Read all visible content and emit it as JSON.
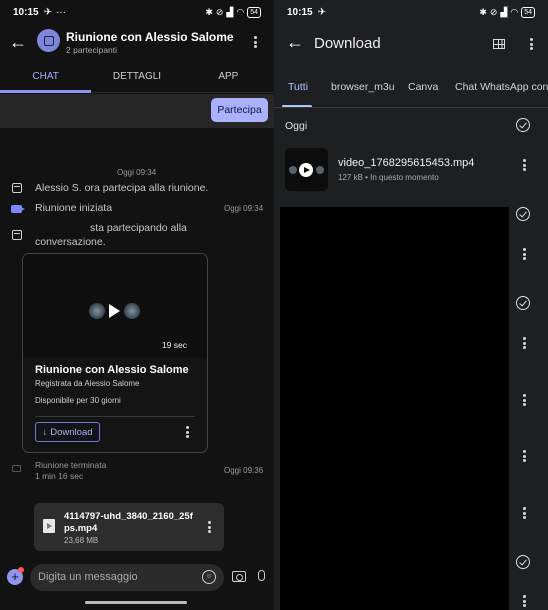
{
  "left": {
    "status": {
      "time": "10:15",
      "battery": "54"
    },
    "header": {
      "title": "Riunione con Alessio Salome",
      "subtitle": "2 partecipanti"
    },
    "tabs": [
      "CHAT",
      "DETTAGLI",
      "APP"
    ],
    "join_button": "Partecipa",
    "chat": {
      "timestamp1": "Oggi 09:34",
      "event_joined": "Alessio S. ora partecipa alla riunione.",
      "event_started": "Riunione iniziata",
      "event_started_time": "Oggi 09:34",
      "event_participating": "sta partecipando alla conversazione.",
      "recording": {
        "duration": "19 sec",
        "title": "Riunione con Alessio Salome",
        "subtitle": "Registrata da Alessio Salome",
        "availability": "Disponibile per 30 giorni",
        "download_label": "Download"
      },
      "event_ended": "Riunione terminata",
      "event_ended_duration": "1 min 16 sec",
      "event_ended_time": "Oggi 09:36",
      "file": {
        "name": "4114797-uhd_3840_2160_25fps.mp4",
        "size": "23,68 MB"
      }
    },
    "input": {
      "placeholder": "Digita un messaggio"
    }
  },
  "right": {
    "status": {
      "time": "10:15",
      "battery": "54"
    },
    "header": {
      "title": "Download"
    },
    "chips": [
      "Tutti",
      "browser_m3u",
      "Canva",
      "Chat WhatsApp con A"
    ],
    "section": "Oggi",
    "item": {
      "name": "video_1768295615453.mp4",
      "meta": "127 kB • In questo momento"
    }
  },
  "colors": {
    "accent": "#aab1ff",
    "right_accent": "#a7c7ff",
    "background": "#121212"
  }
}
